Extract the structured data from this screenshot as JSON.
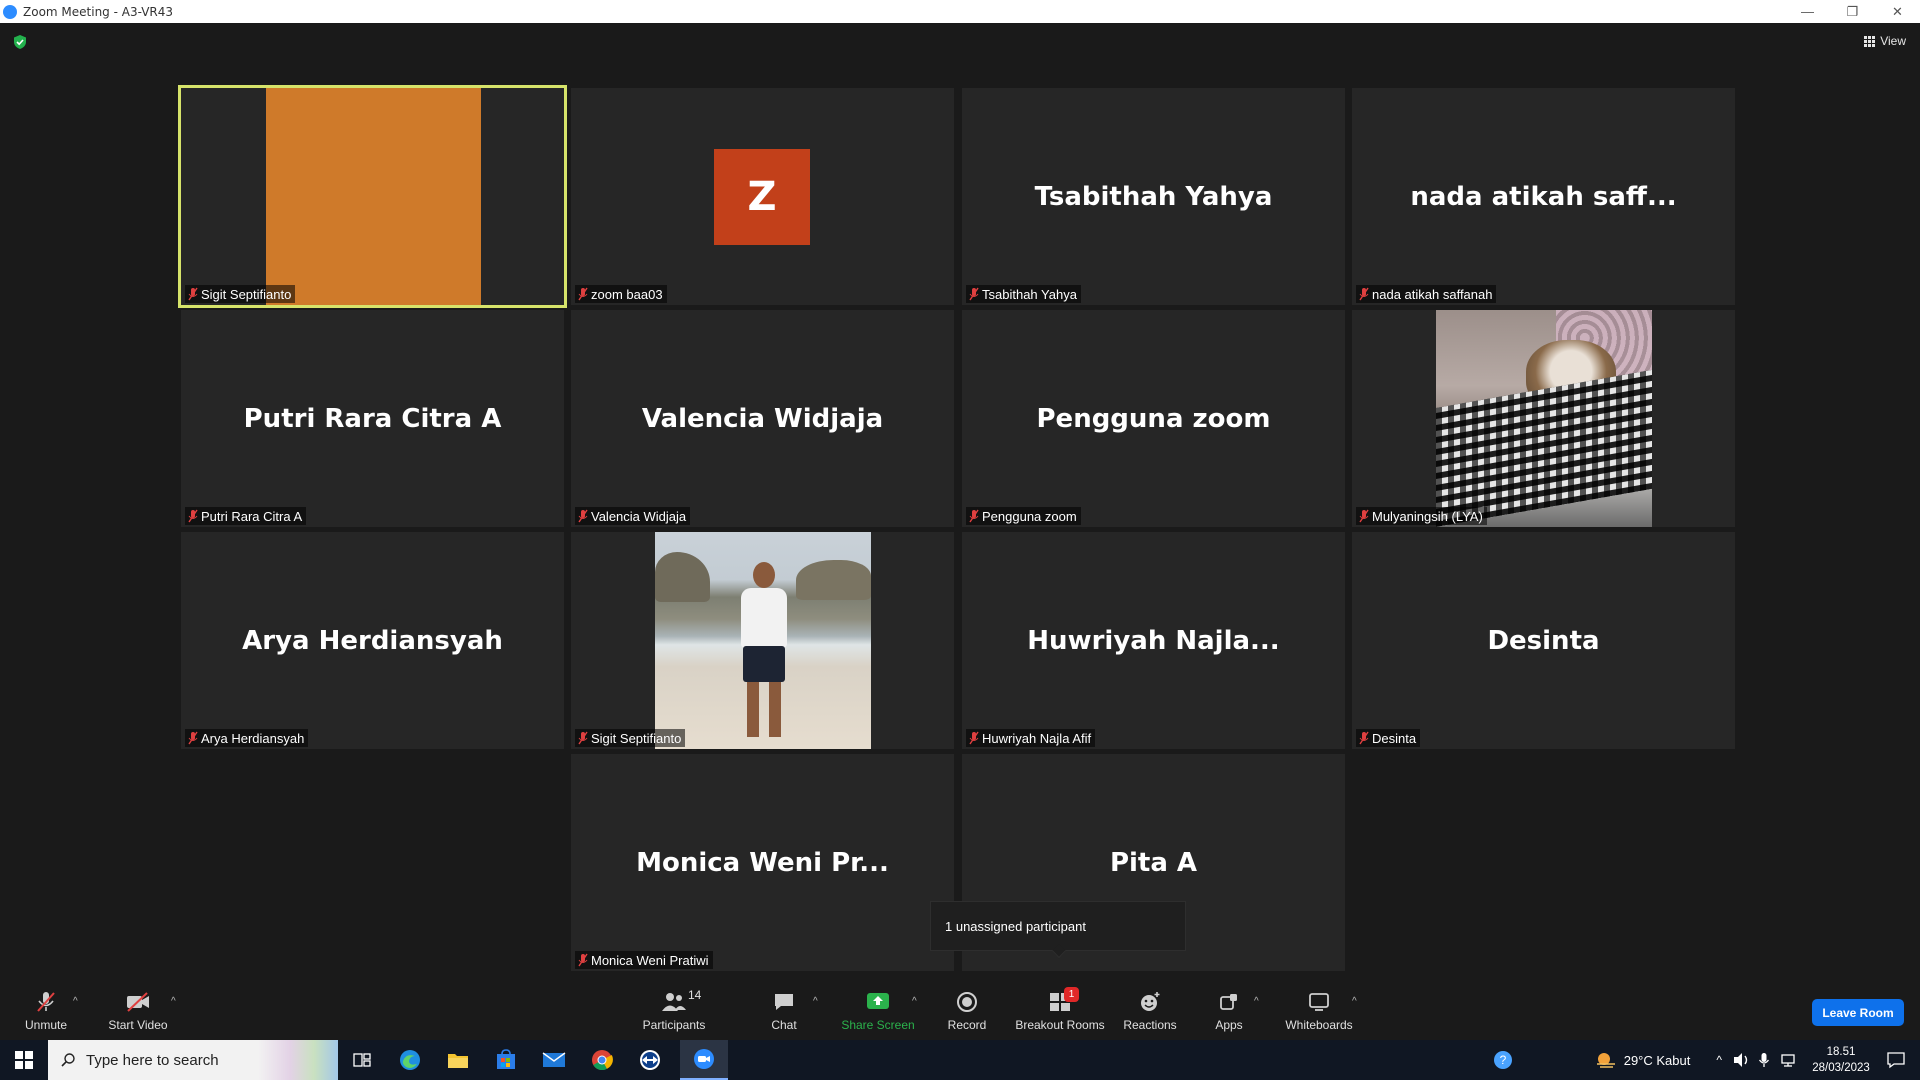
{
  "window": {
    "title": "Zoom Meeting - A3-VR43",
    "controls": [
      "—",
      "❐",
      "✕"
    ]
  },
  "top": {
    "view_label": "View"
  },
  "tiles": [
    {
      "big_name": "",
      "label": "Sigit Septifianto"
    },
    {
      "big_name": "Z",
      "label": "zoom baa03"
    },
    {
      "big_name": "Tsabithah Yahya",
      "label": "Tsabithah Yahya"
    },
    {
      "big_name": "nada atikah saff...",
      "label": "nada atikah saffanah"
    },
    {
      "big_name": "Putri Rara Citra A",
      "label": "Putri Rara Citra A"
    },
    {
      "big_name": "Valencia Widjaja",
      "label": "Valencia Widjaja"
    },
    {
      "big_name": "Pengguna zoom",
      "label": "Pengguna zoom"
    },
    {
      "big_name": "",
      "label": "Mulyaningsih (LYA)"
    },
    {
      "big_name": "Arya Herdiansyah",
      "label": "Arya Herdiansyah"
    },
    {
      "big_name": "",
      "label": "Sigit Septifianto"
    },
    {
      "big_name": "Huwriyah  Najla...",
      "label": "Huwriyah Najla Afif"
    },
    {
      "big_name": "Desinta",
      "label": "Desinta"
    },
    {
      "big_name": "Monica Weni Pr...",
      "label": "Monica Weni Pratiwi"
    },
    {
      "big_name": "Pita A",
      "label": ""
    }
  ],
  "popup": {
    "text": "1 unassigned participant"
  },
  "toolbar": {
    "unmute": "Unmute",
    "start_video": "Start Video",
    "participants": "Participants",
    "participants_count": "14",
    "chat": "Chat",
    "share_screen": "Share Screen",
    "record": "Record",
    "breakout_rooms": "Breakout Rooms",
    "breakout_badge": "1",
    "reactions": "Reactions",
    "apps": "Apps",
    "whiteboards": "Whiteboards",
    "leave": "Leave Room",
    "share_color": "#2bb24c"
  },
  "taskbar": {
    "search_placeholder": "Type here to search",
    "weather": "29°C  Kabut",
    "time": "18.51",
    "date": "28/03/2023"
  }
}
